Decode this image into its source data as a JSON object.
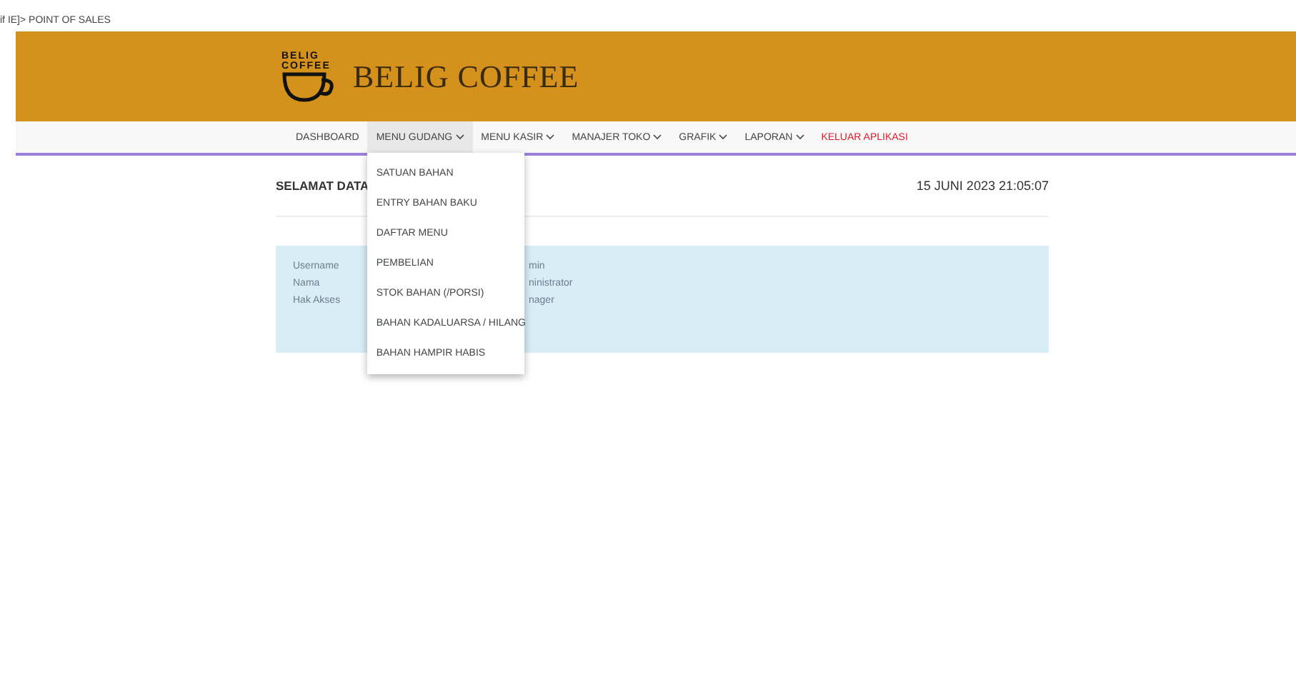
{
  "page_title": "if IE]> POINT OF SALES",
  "header": {
    "logo_lines": [
      "BELIG",
      "COFFEE"
    ],
    "brand": "BELIG COFFEE"
  },
  "nav": [
    {
      "label": "DASHBOARD",
      "kind": "link",
      "dropdown": false,
      "expanded": false
    },
    {
      "label": "MENU GUDANG",
      "kind": "link",
      "dropdown": true,
      "expanded": true
    },
    {
      "label": "MENU KASIR",
      "kind": "link",
      "dropdown": true,
      "expanded": false
    },
    {
      "label": "MANAJER TOKO",
      "kind": "link",
      "dropdown": true,
      "expanded": false
    },
    {
      "label": "GRAFIK",
      "kind": "link",
      "dropdown": true,
      "expanded": false
    },
    {
      "label": "LAPORAN",
      "kind": "link",
      "dropdown": true,
      "expanded": false
    },
    {
      "label": "KELUAR APLIKASI",
      "kind": "danger",
      "dropdown": false,
      "expanded": false
    }
  ],
  "dropdown_menu": [
    "SATUAN BAHAN",
    "ENTRY BAHAN BAKU",
    "DAFTAR MENU",
    "PEMBELIAN",
    "STOK BAHAN (/PORSI)",
    "BAHAN KADALUARSA / HILANG",
    "BAHAN HAMPIR HABIS"
  ],
  "heading": "SELAMAT DATA",
  "datetime": "15 JUNI 2023 21:05:07",
  "info": [
    {
      "label": "Username",
      "value": "min"
    },
    {
      "label": "Nama",
      "value": "ninistrator"
    },
    {
      "label": "Hak Akses",
      "value": "nager"
    }
  ]
}
